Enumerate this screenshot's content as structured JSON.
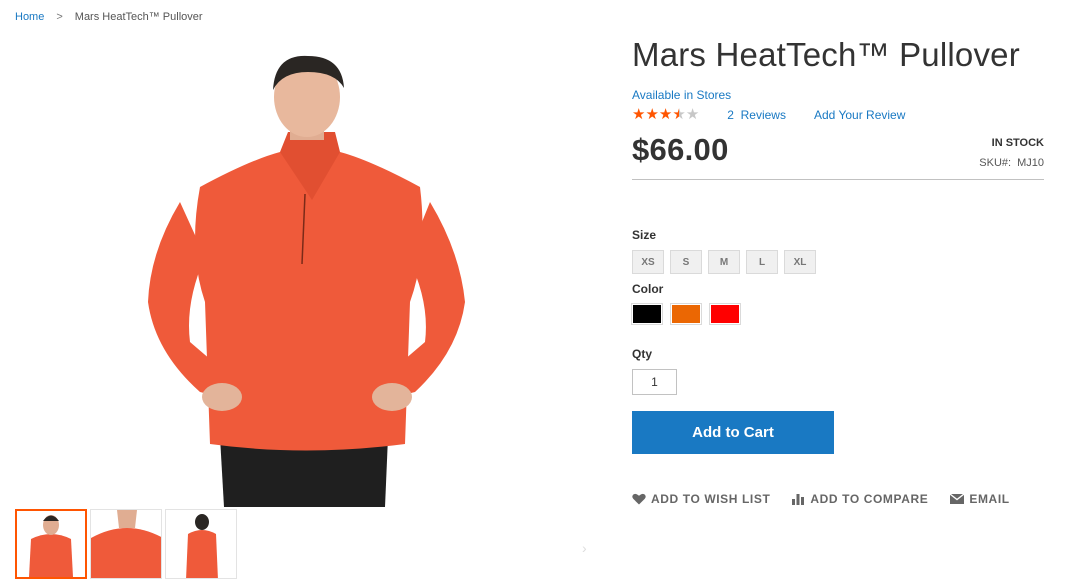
{
  "breadcrumb": {
    "home": "Home",
    "separator": ">",
    "current": "Mars HeatTech™ Pullover"
  },
  "product": {
    "title": "Mars HeatTech™ Pullover",
    "availability": "Available in Stores",
    "rating": 3.5,
    "rating_max": 5,
    "reviews_count": "2",
    "reviews_word": "Reviews",
    "add_review": "Add Your Review",
    "price": "$66.00",
    "stock": "IN STOCK",
    "sku_label": "SKU#:",
    "sku": "MJ10"
  },
  "options": {
    "size_label": "Size",
    "sizes": [
      "XS",
      "S",
      "M",
      "L",
      "XL"
    ],
    "color_label": "Color",
    "colors": [
      {
        "name": "Black",
        "hex": "#000000"
      },
      {
        "name": "Orange",
        "hex": "#eb6703"
      },
      {
        "name": "Red",
        "hex": "#ff0000"
      }
    ]
  },
  "qty": {
    "label": "Qty",
    "value": "1"
  },
  "add_to_cart": "Add to Cart",
  "actions": {
    "wishlist": "ADD TO WISH LIST",
    "compare": "ADD TO COMPARE",
    "email": "EMAIL"
  },
  "colors": {
    "accent": "#1979c3",
    "star": "#ff5501",
    "thumb_active_border": "#ff5501",
    "garment": "#ef5a3a"
  }
}
